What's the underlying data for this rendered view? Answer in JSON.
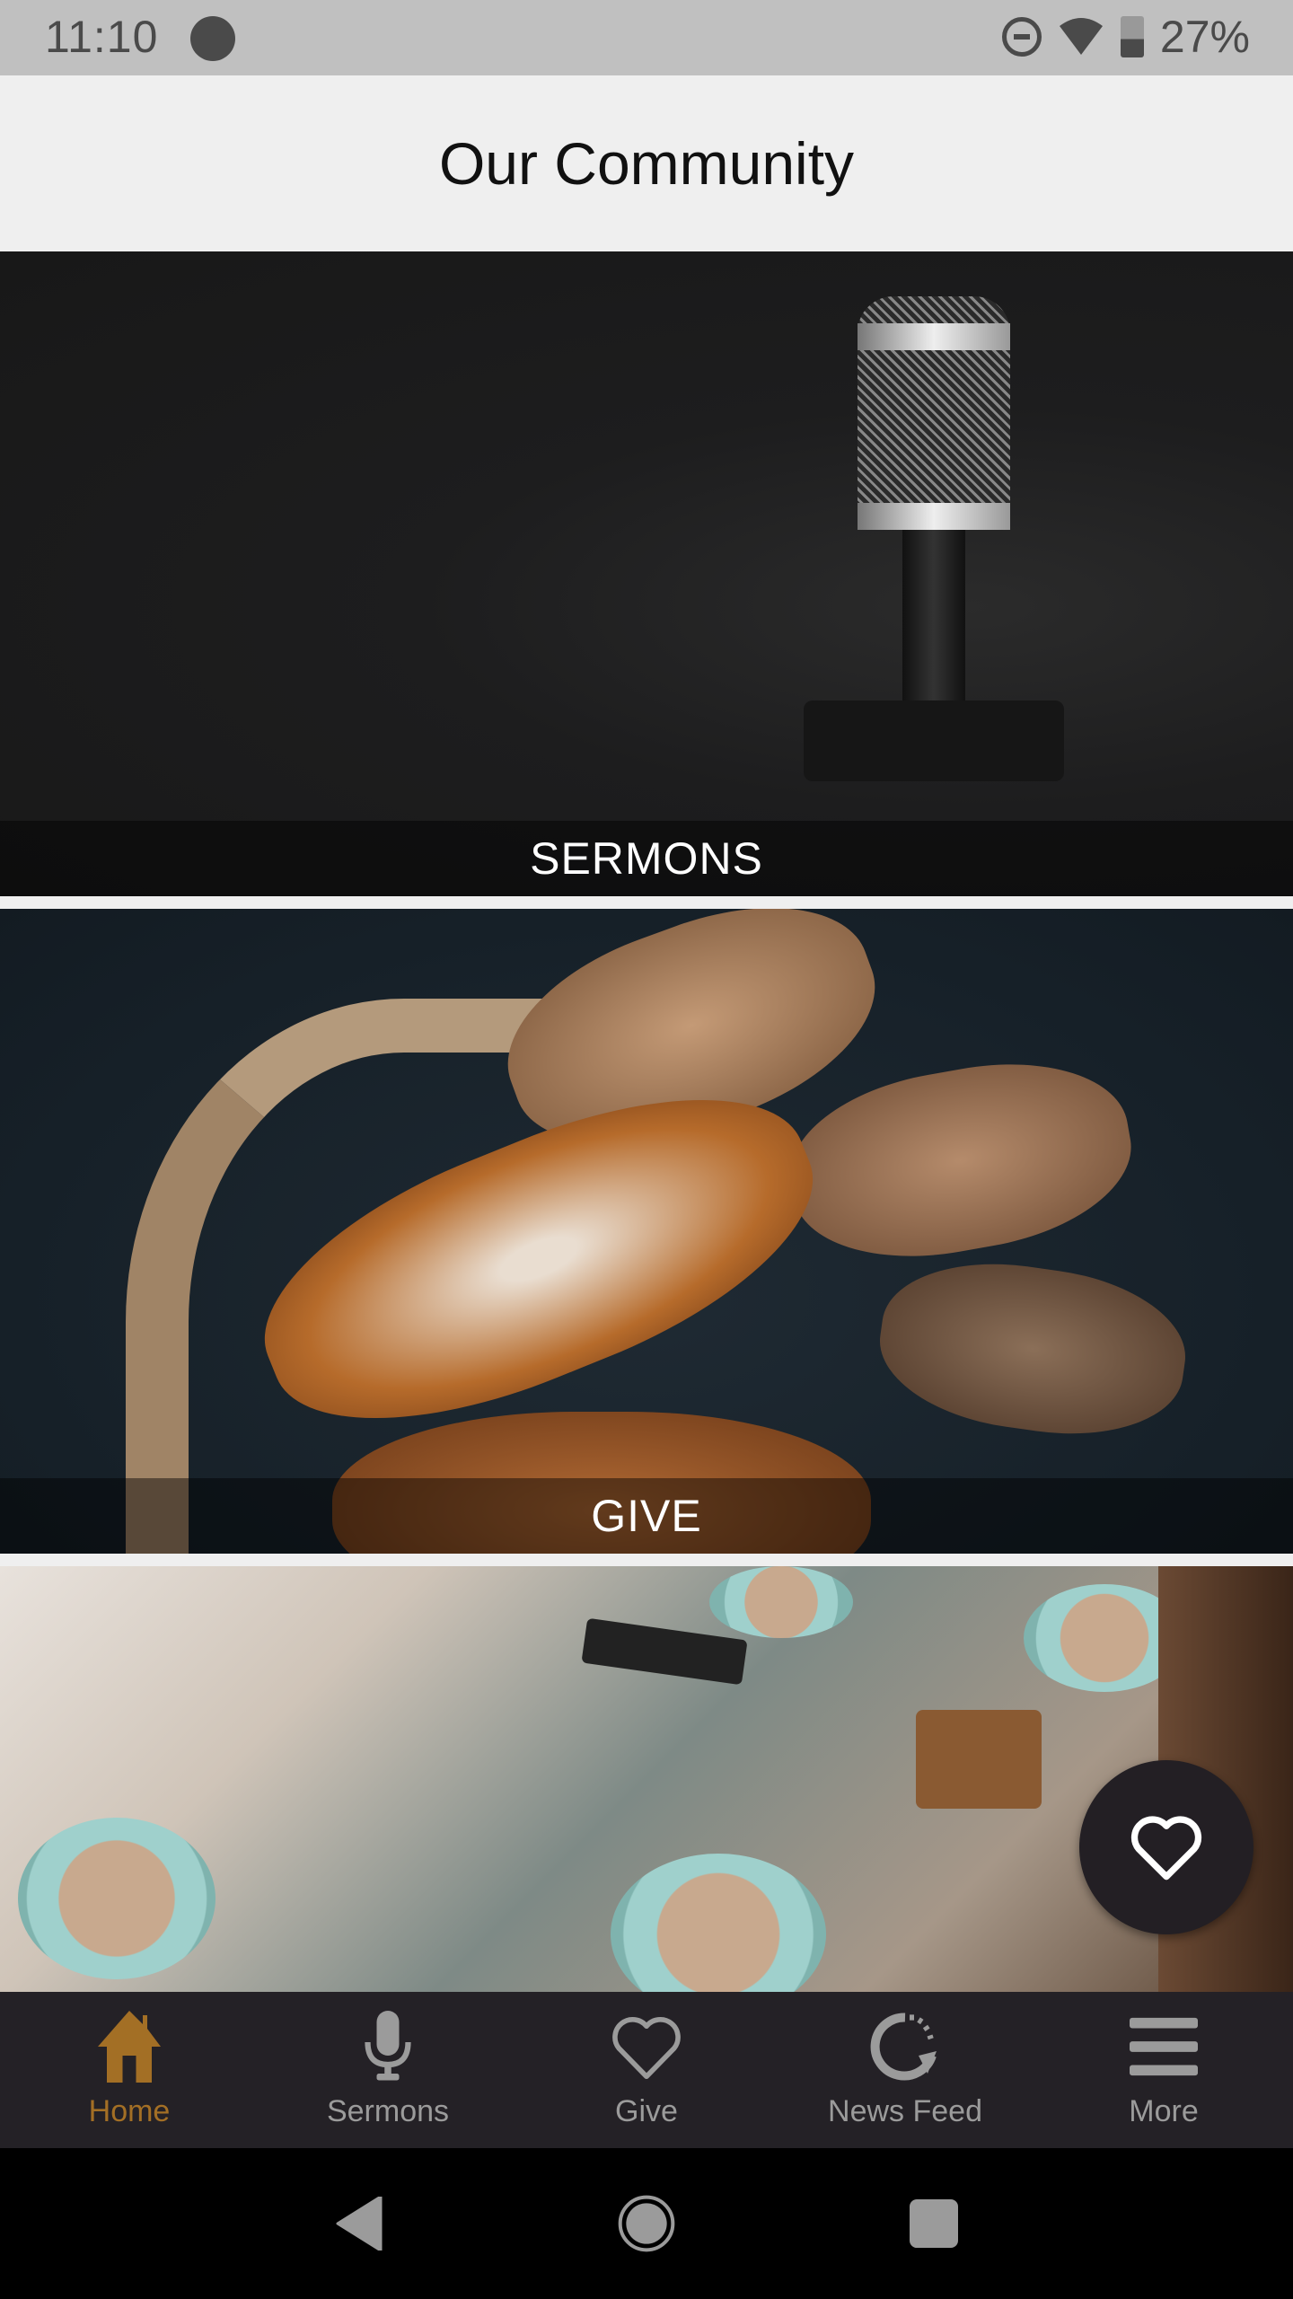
{
  "status_bar": {
    "time": "11:10",
    "battery_percent": "27%",
    "icons": [
      "notification-dot-icon",
      "do-not-disturb-icon",
      "wifi-icon",
      "battery-charging-icon"
    ]
  },
  "header": {
    "title": "Our Community"
  },
  "tiles": [
    {
      "label": "SERMONS",
      "image": "microphone-photo"
    },
    {
      "label": "GIVE",
      "image": "bread-basket-photo"
    },
    {
      "label": "",
      "image": "coffee-table-photo"
    }
  ],
  "fab": {
    "icon": "heart-icon"
  },
  "tabbar": {
    "active_color": "#a36f25",
    "inactive_color": "#9b9b9b",
    "tabs": [
      {
        "label": "Home",
        "icon": "home-icon",
        "active": true
      },
      {
        "label": "Sermons",
        "icon": "microphone-icon",
        "active": false
      },
      {
        "label": "Give",
        "icon": "heart-icon",
        "active": false
      },
      {
        "label": "News Feed",
        "icon": "refresh-icon",
        "active": false
      },
      {
        "label": "More",
        "icon": "menu-icon",
        "active": false
      }
    ]
  },
  "navbar": {
    "buttons": [
      "back-icon",
      "home-circle-icon",
      "recents-icon"
    ]
  }
}
